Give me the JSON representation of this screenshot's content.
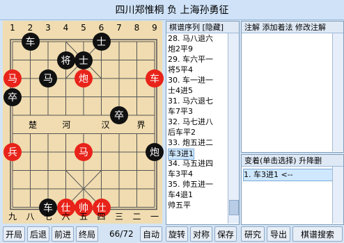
{
  "title": "四川郑惟桐  负  上海孙勇征",
  "board": {
    "top_files": [
      "1",
      "2",
      "3",
      "4",
      "5",
      "6",
      "7",
      "8",
      "9"
    ],
    "bottom_files": [
      "九",
      "八",
      "七",
      "六",
      "五",
      "四",
      "三",
      "二",
      "一"
    ],
    "river_left": [
      "楚",
      "河"
    ],
    "river_right": [
      "汉",
      "界"
    ],
    "pieces": [
      {
        "color": "black",
        "char": "车",
        "file": 1,
        "rank": 0
      },
      {
        "color": "black",
        "char": "士",
        "file": 5,
        "rank": 0
      },
      {
        "color": "black",
        "char": "将",
        "file": 3,
        "rank": 1
      },
      {
        "color": "black",
        "char": "士",
        "file": 4,
        "rank": 1
      },
      {
        "color": "red",
        "char": "马",
        "file": 0,
        "rank": 2
      },
      {
        "color": "black",
        "char": "马",
        "file": 2,
        "rank": 2
      },
      {
        "color": "red",
        "char": "炮",
        "file": 4,
        "rank": 2
      },
      {
        "color": "red",
        "char": "车",
        "file": 8,
        "rank": 2
      },
      {
        "color": "black",
        "char": "卒",
        "file": 0,
        "rank": 3
      },
      {
        "color": "black",
        "char": "卒",
        "file": 6,
        "rank": 4
      },
      {
        "color": "red",
        "char": "兵",
        "file": 0,
        "rank": 6
      },
      {
        "color": "red",
        "char": "马",
        "file": 4,
        "rank": 6
      },
      {
        "color": "black",
        "char": "炮",
        "file": 8,
        "rank": 6
      },
      {
        "color": "black",
        "char": "车",
        "file": 2,
        "rank": 9
      },
      {
        "color": "red",
        "char": "仕",
        "file": 3,
        "rank": 9
      },
      {
        "color": "red",
        "char": "帅",
        "file": 4,
        "rank": 9
      },
      {
        "color": "red",
        "char": "仕",
        "file": 5,
        "rank": 9
      }
    ]
  },
  "moves_panel": {
    "header": "棋谱序列  [隐藏]",
    "rows": [
      "28. 马八退六",
      "    炮2平9",
      "29. 车六平一",
      "    将5平4",
      "30. 车一进一",
      "    士4进5",
      "31. 马六退七",
      "    车7平3",
      "32. 马七进八",
      "    后车平2",
      "33. 炮五进二",
      "    车3进1",
      "34. 马五进四",
      "    车3平4",
      "35. 帅五进一",
      "    车4退1",
      "    帅五平"
    ],
    "selected_index": 11
  },
  "notes_panel": {
    "header": "注解  添加着法  修改注解"
  },
  "variation_panel": {
    "header": "变着(单击选择)   升降删",
    "item": "1. 车3进1        <--"
  },
  "controls": {
    "start": "开局",
    "back": "后退",
    "forward": "前进",
    "end": "终局",
    "move_count": "66/72",
    "auto": "自动",
    "rotate": "旋转",
    "compare": "对称",
    "save": "保存",
    "study": "研究",
    "export": "导出",
    "search": "棋谱搜索"
  },
  "colors": {
    "board": "#f0dcb0",
    "red_piece": "#e8231a",
    "black_piece": "#111111",
    "selection": "#cfe8ff"
  }
}
